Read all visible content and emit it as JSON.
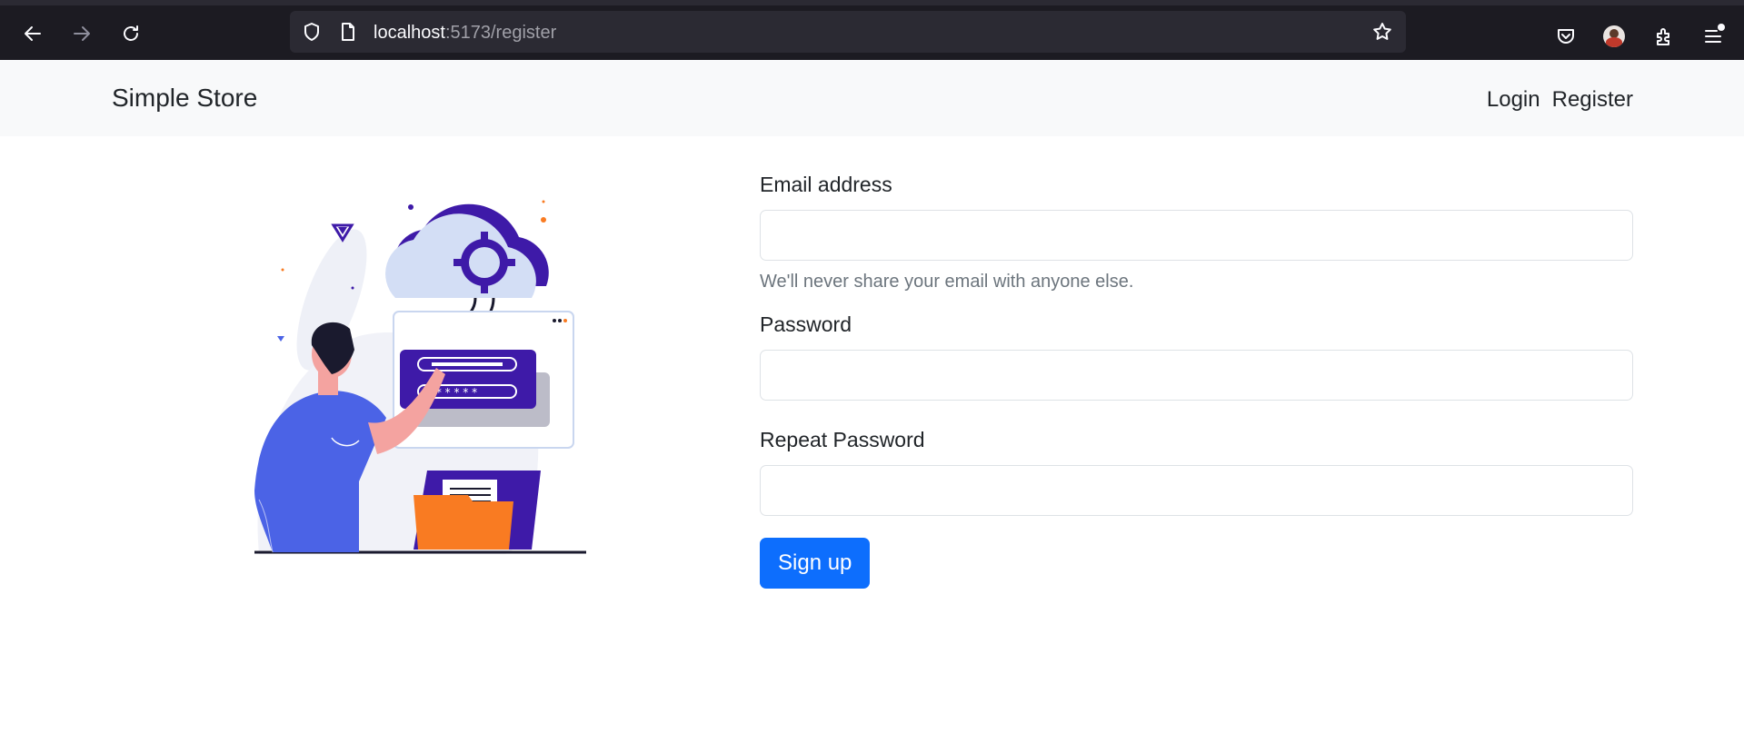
{
  "browser": {
    "url_host": "localhost",
    "url_path": ":5173/register"
  },
  "navbar": {
    "brand": "Simple Store",
    "links": [
      "Login",
      "Register"
    ]
  },
  "form": {
    "email_label": "Email address",
    "email_help": "We'll never share your email with anyone else.",
    "password_label": "Password",
    "repeat_label": "Repeat Password",
    "submit_label": "Sign up"
  },
  "colors": {
    "primary": "#0d6efd",
    "navbar_bg": "#f8f9fa",
    "chrome_bg": "#1c1b22"
  },
  "icons": [
    "back-arrow-icon",
    "forward-arrow-icon",
    "reload-icon",
    "shield-icon",
    "page-icon",
    "star-icon",
    "pocket-icon",
    "extensions-icon",
    "menu-icon"
  ]
}
